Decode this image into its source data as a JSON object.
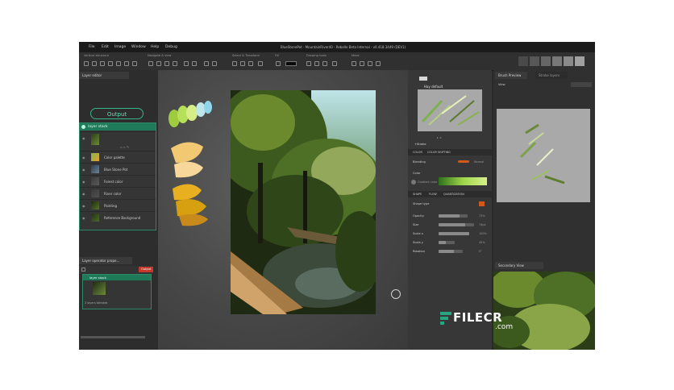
{
  "window": {
    "title": "BlueStonePot - MountainRiver40 - Rebelle Beta Internal - v0.418.3449 (DEV1)"
  },
  "menu": [
    "File",
    "Edit",
    "Image",
    "Window",
    "Help",
    "Debug"
  ],
  "toolbar": {
    "groups": [
      "Vertical structure",
      "Navigate & view",
      "Select & Transform",
      "Fill",
      "Drawing tools",
      "Move"
    ]
  },
  "left_panel": {
    "tab_layer_editor": "Layer editor",
    "output_label": "Output",
    "stack_title": "layer stack",
    "layers": [
      "Color palette",
      "Blue Stone Pot",
      "Forest color",
      "River color",
      "Painting",
      "Reference Background"
    ],
    "tab_layer_props": "Layer operator prope...",
    "output_badge": "Output",
    "props_stack_title": "layer stack",
    "props_status": "2 layers blended"
  },
  "mid_panel": {
    "preset_label": "Hay default",
    "section_label": "+Stroke",
    "tabs_top": [
      "COLOR",
      "COLOR SHIFTING"
    ],
    "blending_label": "Blending",
    "blending_value": "Normal",
    "color_label": "Color",
    "color_sublabel": "Gradient color",
    "tabs_shape": [
      "SHAPE",
      "FLOW",
      "QUANTIZATION"
    ],
    "shape_type_label": "Shape type",
    "params": [
      {
        "name": "Opacity",
        "value": "73%",
        "fill": 0.73
      },
      {
        "name": "Size",
        "value": "74px",
        "fill": 0.74
      },
      {
        "name": "Scale x",
        "value": "100%",
        "fill": 1.0
      },
      {
        "name": "Scale y",
        "value": "45%",
        "fill": 0.45
      },
      {
        "name": "Rotation",
        "value": "0°",
        "fill": 0.62
      }
    ]
  },
  "right_panel": {
    "tab_brush_preview": "Brush Preview",
    "tab_stroke": "Stroke layers",
    "view_label": "View",
    "tab_secondary": "Secondary View"
  },
  "watermark": {
    "brand": "FILECR",
    "domain": ".com"
  },
  "colors": {
    "accent": "#37b489",
    "stack_header": "#1f7a5a",
    "badge": "#c0392b"
  }
}
